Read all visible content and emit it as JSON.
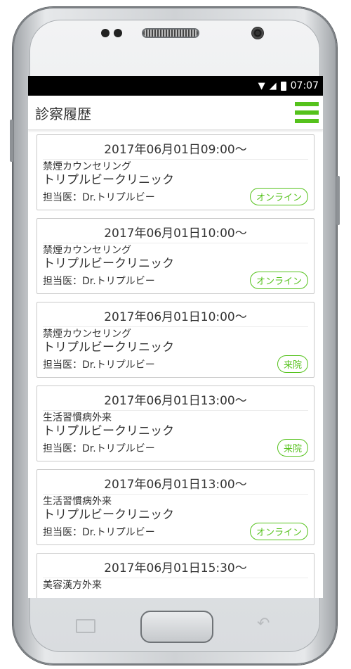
{
  "status_bar": {
    "time": "07:07",
    "wifi_icon": "wifi-icon",
    "signal_icon": "signal-icon",
    "battery_icon": "battery-icon"
  },
  "header": {
    "title": "診察履歴",
    "menu_icon": "hamburger-menu-icon"
  },
  "accent_color": "#55c21c",
  "visits": [
    {
      "date": "2017年06月01日09:00～",
      "department": "禁煙カウンセリング",
      "clinic": "トリプルビークリニック",
      "doctor": "担当医：Dr.トリプルビー",
      "type": "オンライン"
    },
    {
      "date": "2017年06月01日10:00～",
      "department": "禁煙カウンセリング",
      "clinic": "トリプルビークリニック",
      "doctor": "担当医：Dr.トリプルビー",
      "type": "オンライン"
    },
    {
      "date": "2017年06月01日10:00～",
      "department": "禁煙カウンセリング",
      "clinic": "トリプルビークリニック",
      "doctor": "担当医：Dr.トリプルビー",
      "type": "来院"
    },
    {
      "date": "2017年06月01日13:00～",
      "department": "生活習慣病外来",
      "clinic": "トリプルビークリニック",
      "doctor": "担当医：Dr.トリプルビー",
      "type": "来院"
    },
    {
      "date": "2017年06月01日13:00～",
      "department": "生活習慣病外来",
      "clinic": "トリプルビークリニック",
      "doctor": "担当医：Dr.トリプルビー",
      "type": "オンライン"
    },
    {
      "date": "2017年06月01日15:30～",
      "department": "美容漢方外来",
      "clinic": "",
      "doctor": "",
      "type": ""
    }
  ]
}
